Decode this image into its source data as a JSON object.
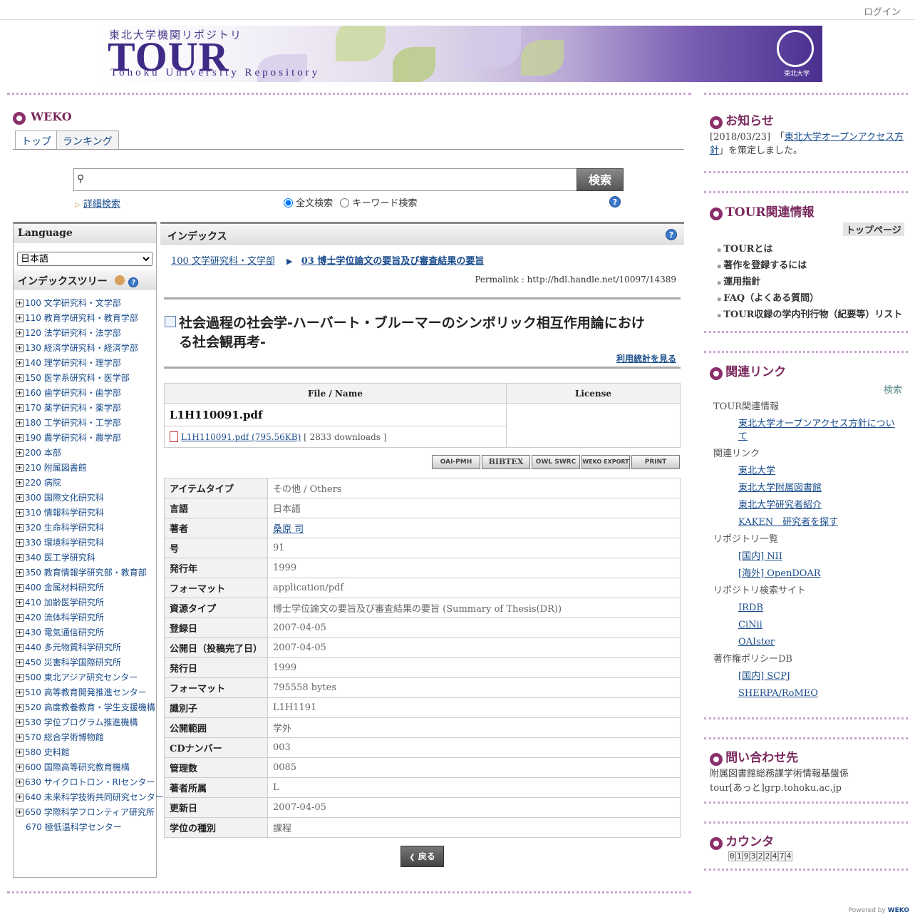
{
  "header": {
    "login": "ログイン"
  },
  "banner": {
    "subtitle_ja": "東北大学機関リポジトリ",
    "title": "TOUR",
    "title_en": "Tohoku University Repository",
    "seal_label": "東北大学"
  },
  "weko": {
    "title": "WEKO",
    "tabs": [
      {
        "label": "トップ"
      },
      {
        "label": "ランキング"
      }
    ]
  },
  "search": {
    "button": "検索",
    "advanced": "詳細検索",
    "mode_fulltext": "全文検索",
    "mode_keyword": "キーワード検索",
    "help": "?"
  },
  "language_panel": {
    "title": "Language",
    "selected": "日本語"
  },
  "index_tree": {
    "title": "インデックスツリー",
    "items": [
      "100 文学研究科・文学部",
      "110 教育学研究科・教育学部",
      "120 法学研究科・法学部",
      "130 経済学研究科・経済学部",
      "140 理学研究科・理学部",
      "150 医学系研究科・医学部",
      "160 歯学研究科・歯学部",
      "170 薬学研究科・薬学部",
      "180 工学研究科・工学部",
      "190 農学研究科・農学部",
      "200 本部",
      "210 附属図書館",
      "220 病院",
      "300 国際文化研究科",
      "310 情報科学研究科",
      "320 生命科学研究科",
      "330 環境科学研究科",
      "340 医工学研究科",
      "350 教育情報学研究部・教育部",
      "400 金属材料研究所",
      "410 加齢医学研究所",
      "420 流体科学研究所",
      "430 電気通信研究所",
      "440 多元物質科学研究所",
      "450 災害科学国際研究所",
      "500 東北アジア研究センター",
      "510 高等教育開発推進センター",
      "520 高度教養教育・学生支援機構",
      "530 学位プログラム推進機構",
      "570 総合学術博物館",
      "580 史料館",
      "600 国際高等研究教育機構",
      "630 サイクロトロン・RIセンター",
      "640 未来科学技術共同研究センター",
      "650 学際科学フロンティア研究所"
    ],
    "last_item": "670 極低温科学センター"
  },
  "main": {
    "panel_title": "インデックス",
    "breadcrumb": [
      "100 文学研究科・文学部",
      "03 博士学位論文の要旨及び審査結果の要旨"
    ],
    "permalink": "Permalink : http://hdl.handle.net/10097/14389",
    "item_title_line1": "社会過程の社会学-ハーバート・ブルーマーのシンボリック相互作用論におけ",
    "item_title_line2": "る社会観再考-",
    "stats_link": "利用統計を見る",
    "file_table": {
      "col_file": "File / Name",
      "col_license": "License",
      "file_name": "L1H110091.pdf",
      "file_link": " L1H110091.pdf  (795.56KB)",
      "downloads": "[ 2833 downloads ]"
    },
    "exports": [
      "OAI-PMH",
      "BIBTEX",
      "OWL SWRC",
      "WEKO EXPORT",
      "PRINT"
    ],
    "metadata": [
      {
        "k": "アイテムタイプ",
        "v": "その他 / Others"
      },
      {
        "k": "言語",
        "v": "日本語"
      },
      {
        "k": "著者",
        "v": "桑原 司",
        "link": true
      },
      {
        "k": "号",
        "v": "91"
      },
      {
        "k": "発行年",
        "v": "1999"
      },
      {
        "k": "フォーマット",
        "v": "application/pdf"
      },
      {
        "k": "資源タイプ",
        "v": "博士学位論文の要旨及び審査結果の要旨 (Summary of Thesis(DR))"
      },
      {
        "k": "登録日",
        "v": "2007-04-05"
      },
      {
        "k": "公開日（投稿完了日）",
        "v": "2007-04-05"
      },
      {
        "k": "発行日",
        "v": "1999"
      },
      {
        "k": "フォーマット",
        "v": "795558 bytes"
      },
      {
        "k": "識別子",
        "v": "L1H1191"
      },
      {
        "k": "公開範囲",
        "v": "学外"
      },
      {
        "k": "CDナンバー",
        "v": "003"
      },
      {
        "k": "管理数",
        "v": "0085"
      },
      {
        "k": "著者所属",
        "v": "L"
      },
      {
        "k": "更新日",
        "v": "2007-04-05"
      },
      {
        "k": "学位の種別",
        "v": "課程"
      }
    ],
    "back_button": "戻る"
  },
  "sidebar": {
    "news": {
      "title": "お知らせ",
      "date": "[2018/03/23]",
      "pre": "「",
      "link": "東北大学オープンアクセス方針",
      "post": "」を策定しました。"
    },
    "tour_info": {
      "title": "TOUR関連情報",
      "top_page": "トップページ",
      "items": [
        "TOURとは",
        "著作を登録するには",
        "運用指針",
        "FAQ（よくある質問）",
        "TOUR収録の学内刊行物（紀要等）リスト"
      ]
    },
    "links": {
      "title": "関連リンク",
      "search": "検索",
      "groups": [
        {
          "name": "TOUR関連情報",
          "links": [
            "東北大学オープンアクセス方針について"
          ]
        },
        {
          "name": "関連リンク",
          "links": [
            "東北大学",
            "東北大学附属図書館",
            "東北大学研究者紹介",
            "KAKEN　研究者を探す"
          ]
        },
        {
          "name": "リポジトリ一覧",
          "links": [
            "[国内] NII",
            "[海外] OpenDOAR"
          ]
        },
        {
          "name": "リポジトリ検索サイト",
          "links": [
            "IRDB",
            "CiNii",
            "OAIster"
          ]
        },
        {
          "name": "著作権ポリシーDB",
          "links": [
            "[国内] SCPJ",
            "SHERPA/RoMEO"
          ]
        }
      ]
    },
    "contact": {
      "title": "問い合わせ先",
      "line1": "附属図書館総務課学術情報基盤係",
      "line2": "tour[あっと]grp.tohoku.ac.jp"
    },
    "counter": {
      "title": "カウンタ",
      "value": "019322474"
    }
  },
  "footer": {
    "powered": "Powered by",
    "weko": "WEKO"
  }
}
